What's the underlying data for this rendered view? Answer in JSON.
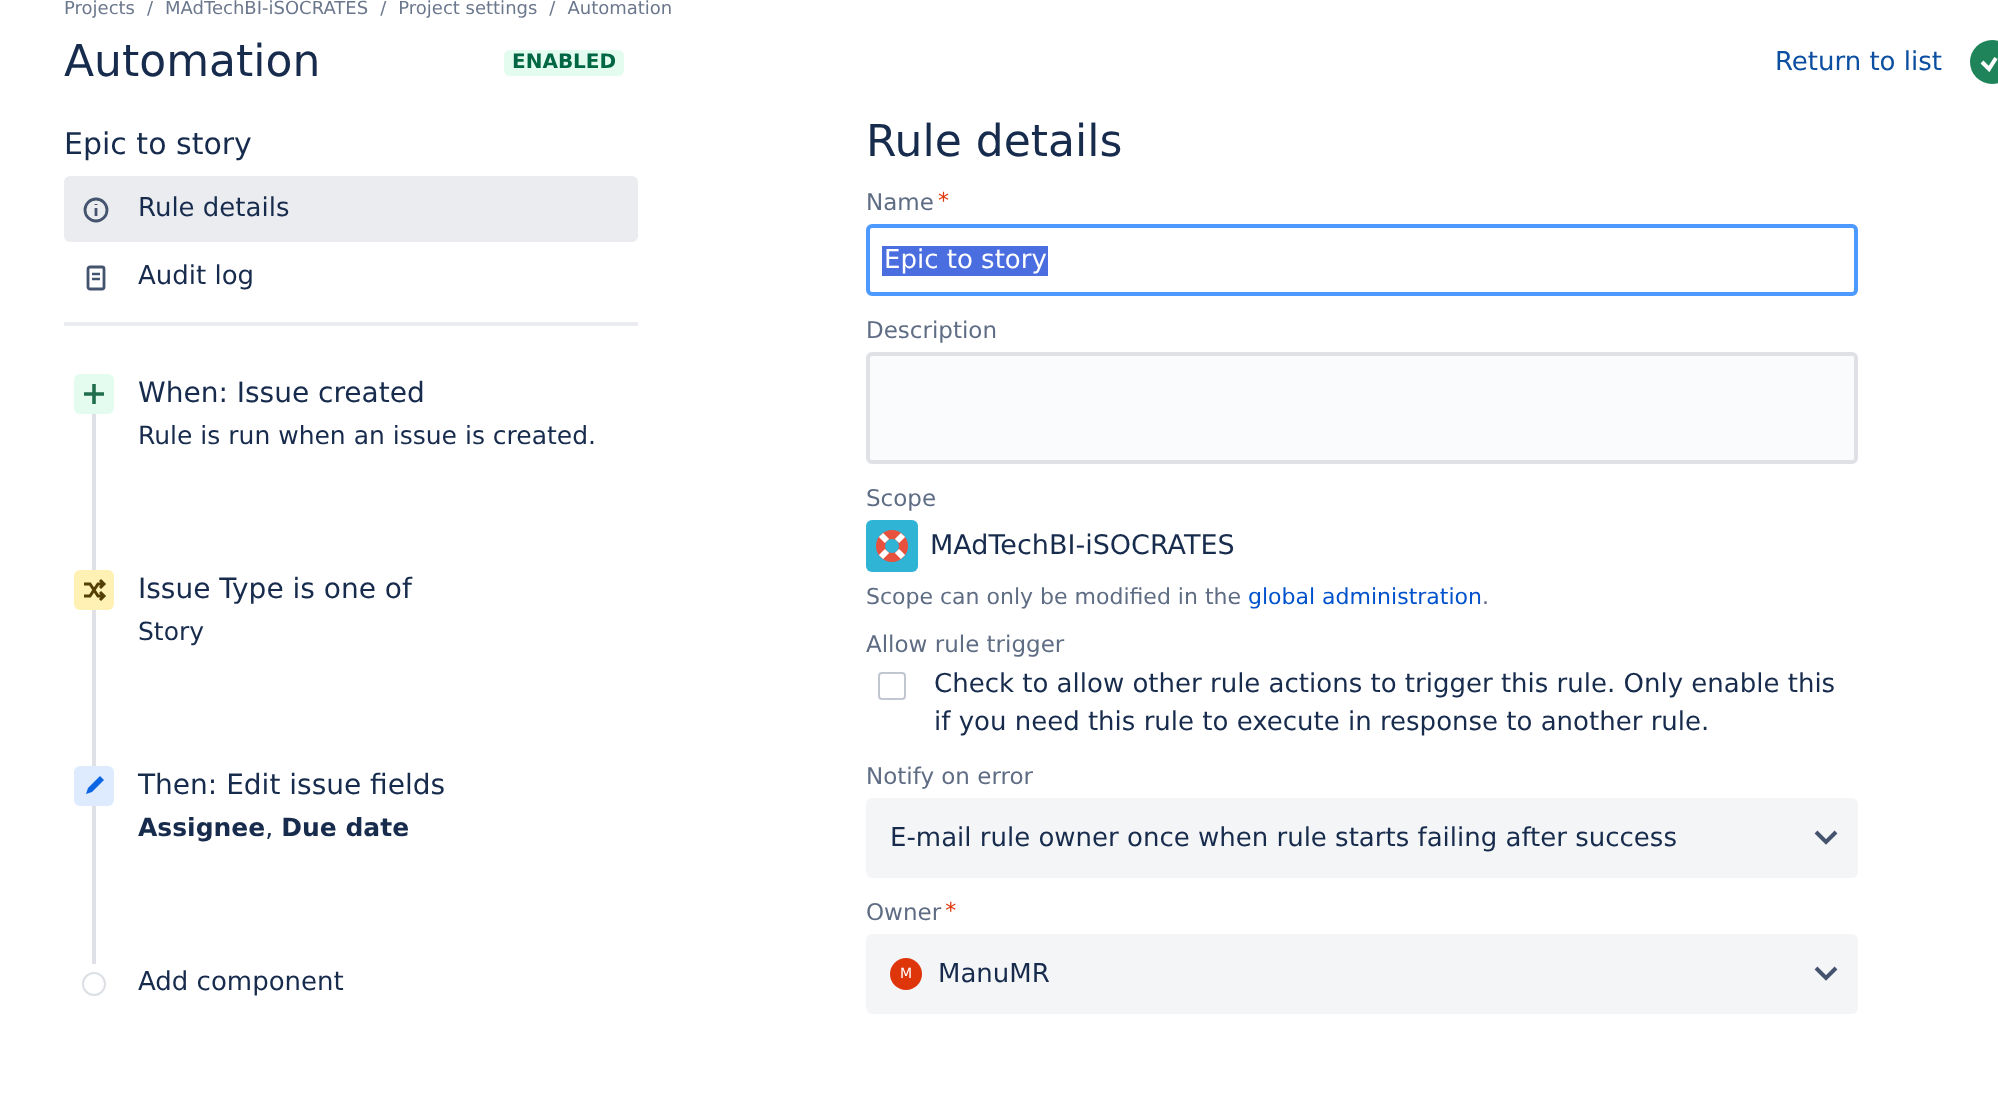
{
  "breadcrumbs": [
    "Projects",
    "MAdTechBI-iSOCRATES",
    "Project settings",
    "Automation"
  ],
  "breadcrumb_separator": "/",
  "header": {
    "title": "Automation",
    "status": "ENABLED",
    "return_link": "Return to list"
  },
  "sidebar": {
    "rule_name": "Epic to story",
    "nav": [
      {
        "label": "Rule details",
        "kind": "info",
        "selected": true
      },
      {
        "label": "Audit log",
        "kind": "log",
        "selected": false
      }
    ],
    "steps": [
      {
        "kind": "trigger",
        "title": "When: Issue created",
        "detail": "Rule is run when an issue is created."
      },
      {
        "kind": "condition",
        "title": "Issue Type is one of",
        "detail": "Story"
      },
      {
        "kind": "action",
        "title": "Then: Edit issue fields",
        "detail": "**Assignee**, **Due date**"
      },
      {
        "kind": "add",
        "title": "Add component"
      }
    ]
  },
  "form": {
    "heading": "Rule details",
    "name": {
      "label": "Name",
      "required_mark": "*",
      "value": "Epic to story"
    },
    "description": {
      "label": "Description"
    },
    "scope": {
      "label": "Scope",
      "project": "MAdTechBI-iSOCRATES",
      "note": "Scope can only be modified in the ",
      "note_link": "global administration",
      "note_end": "."
    },
    "allow_trigger": {
      "label": "Allow rule trigger",
      "checked": false,
      "text": "Check to allow other rule actions to trigger this rule. Only enable this if you need this rule to execute in response to another rule."
    },
    "notify": {
      "label": "Notify on error",
      "value": "E-mail rule owner once when rule starts failing after success"
    },
    "owner": {
      "label": "Owner",
      "required_mark": "*",
      "avatar": "M",
      "value": "ManuMR"
    }
  }
}
